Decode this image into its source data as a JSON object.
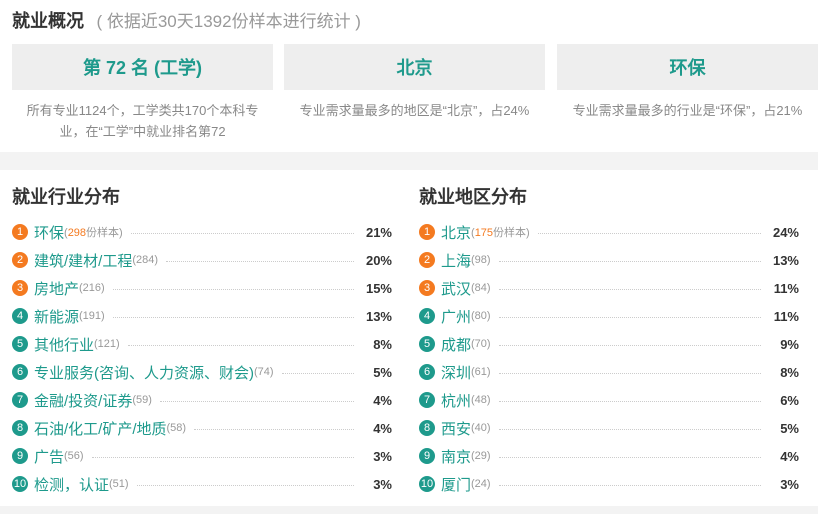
{
  "header": {
    "title": "就业概况",
    "subtitle": "( 依据近30天1392份样本进行统计 )"
  },
  "cards": [
    {
      "value": "第 72 名 (工学)",
      "desc_line1": "所有专业1124个，工学类共170个本科专",
      "desc_line2": "业，在“工学”中就业排名第72"
    },
    {
      "value": "北京",
      "desc_line1": "专业需求量最多的地区是“北京”，占24%",
      "desc_line2": ""
    },
    {
      "value": "环保",
      "desc_line1": "专业需求量最多的行业是“环保”，占21%",
      "desc_line2": ""
    }
  ],
  "industry": {
    "title": "就业行业分布",
    "items": [
      {
        "rank": "1",
        "name": "环保",
        "count": "298",
        "suffix": "份样本",
        "pct": "21%"
      },
      {
        "rank": "2",
        "name": "建筑/建材/工程",
        "count": "(284)",
        "suffix": "",
        "pct": "20%"
      },
      {
        "rank": "3",
        "name": "房地产",
        "count": "(216)",
        "suffix": "",
        "pct": "15%"
      },
      {
        "rank": "4",
        "name": "新能源",
        "count": "(191)",
        "suffix": "",
        "pct": "13%"
      },
      {
        "rank": "5",
        "name": "其他行业",
        "count": "(121)",
        "suffix": "",
        "pct": "8%"
      },
      {
        "rank": "6",
        "name": "专业服务(咨询、人力资源、财会)",
        "count": "(74)",
        "suffix": "",
        "pct": "5%"
      },
      {
        "rank": "7",
        "name": "金融/投资/证券",
        "count": "(59)",
        "suffix": "",
        "pct": "4%"
      },
      {
        "rank": "8",
        "name": "石油/化工/矿产/地质",
        "count": "(58)",
        "suffix": "",
        "pct": "4%"
      },
      {
        "rank": "9",
        "name": "广告",
        "count": "(56)",
        "suffix": "",
        "pct": "3%"
      },
      {
        "rank": "10",
        "name": "检测，认证",
        "count": "(51)",
        "suffix": "",
        "pct": "3%"
      }
    ]
  },
  "region": {
    "title": "就业地区分布",
    "items": [
      {
        "rank": "1",
        "name": "北京",
        "count": "175",
        "suffix": "份样本",
        "pct": "24%"
      },
      {
        "rank": "2",
        "name": "上海",
        "count": "(98)",
        "suffix": "",
        "pct": "13%"
      },
      {
        "rank": "3",
        "name": "武汉",
        "count": "(84)",
        "suffix": "",
        "pct": "11%"
      },
      {
        "rank": "4",
        "name": "广州",
        "count": "(80)",
        "suffix": "",
        "pct": "11%"
      },
      {
        "rank": "5",
        "name": "成都",
        "count": "(70)",
        "suffix": "",
        "pct": "9%"
      },
      {
        "rank": "6",
        "name": "深圳",
        "count": "(61)",
        "suffix": "",
        "pct": "8%"
      },
      {
        "rank": "7",
        "name": "杭州",
        "count": "(48)",
        "suffix": "",
        "pct": "6%"
      },
      {
        "rank": "8",
        "name": "西安",
        "count": "(40)",
        "suffix": "",
        "pct": "5%"
      },
      {
        "rank": "9",
        "name": "南京",
        "count": "(29)",
        "suffix": "",
        "pct": "4%"
      },
      {
        "rank": "10",
        "name": "厦门",
        "count": "(24)",
        "suffix": "",
        "pct": "3%"
      }
    ]
  },
  "colors": {
    "accent": "#1e9a8c",
    "top_rank": "#f47a20",
    "muted": "#999999",
    "card_bg": "#eeeeee"
  }
}
